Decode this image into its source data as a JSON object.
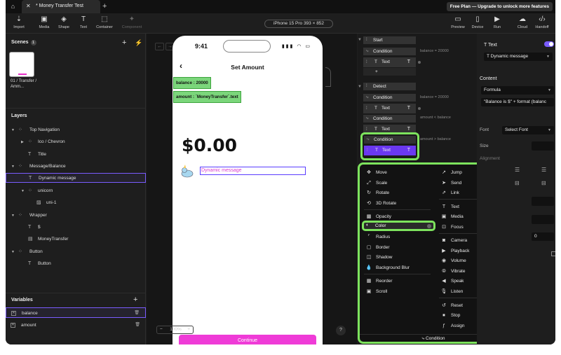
{
  "tabbar": {
    "tab_title": "* Money Transfer Test",
    "new_tab": "+",
    "upgrade": "Free Plan — Upgrade to unlock more features"
  },
  "toolbar": {
    "import": "Import",
    "media": "Media",
    "shape": "Shape",
    "text": "Text",
    "container": "Container",
    "component": "Component",
    "device_selector": "iPhone 15 Pro  393 × 852",
    "preview": "Preview",
    "device": "Device",
    "run": "Run",
    "cloud": "Cloud",
    "handoff": "Handoff"
  },
  "scenes": {
    "heading": "Scenes",
    "count": "1",
    "scene_label": "01 / Transfer / Amm..."
  },
  "layers": {
    "heading": "Layers",
    "items": [
      {
        "label": "Top Navigation",
        "icon": "frame-icon"
      },
      {
        "label": "Ico / Chevron",
        "icon": "frame-icon"
      },
      {
        "label": "Title",
        "icon": "text-icon"
      },
      {
        "label": "Message/Balance",
        "icon": "frame-icon"
      },
      {
        "label": "Dynamic message",
        "icon": "text-icon"
      },
      {
        "label": "unicorn",
        "icon": "frame-icon"
      },
      {
        "label": "uni-1",
        "icon": "image-icon"
      },
      {
        "label": "Wrapper",
        "icon": "frame-icon"
      },
      {
        "label": "$",
        "icon": "text-icon"
      },
      {
        "label": "MoneyTransfer",
        "icon": "component-icon"
      },
      {
        "label": "Button",
        "icon": "frame-icon"
      },
      {
        "label": "Button",
        "icon": "text-icon"
      }
    ]
  },
  "variables": {
    "heading": "Variables",
    "items": [
      {
        "name": "balance"
      },
      {
        "name": "amount"
      }
    ]
  },
  "canvas": {
    "zoom": "100%",
    "zoom_minus": "−",
    "zoom_plus": "+",
    "help": "?"
  },
  "phone": {
    "time": "9:41",
    "status_icons": "▮▮▮ ◠ ▭",
    "back": "‹",
    "title": "Set Amount",
    "chip_balance": "balance : 20000",
    "chip_amount": "amount : `MoneyTransfer`.text",
    "amount_display": "$0.00",
    "dynamic_message": "Dynamic message",
    "cta": "Continue"
  },
  "logic": {
    "nodes": {
      "start": "Start",
      "condition": "Condition",
      "text": "Text",
      "detect": "Detect",
      "t_icon": "T",
      "add": "+"
    },
    "cond_labels": {
      "c1": "balance = 20000",
      "c2": "balance = 20000",
      "c3": "amount < balance",
      "c4": "amount > balance"
    }
  },
  "menu": {
    "left": [
      "Move",
      "Scale",
      "Rotate",
      "3D Rotate",
      "Opacity",
      "Color",
      "Radius",
      "Border",
      "Shadow",
      "Background Blur",
      "Reorder",
      "Scroll"
    ],
    "right": [
      "Jump",
      "Send",
      "Link",
      "Text",
      "Media",
      "Focus",
      "Camera",
      "Playback",
      "Volume",
      "Vibrate",
      "Speak",
      "Listen",
      "Reset",
      "Stop",
      "Assign"
    ],
    "footer": "Condition"
  },
  "props": {
    "component_name": "Text",
    "layer_select": "Dynamic message",
    "content_heading": "Content",
    "content_type": "Formula",
    "formula": "\"Balance is $\" + format (balanc",
    "font_label": "Font",
    "font_select": "Select Font",
    "size_label": "Size",
    "alignment_label": "Alignment",
    "num_value": "0"
  },
  "colors": {
    "accent_green": "#7de35d",
    "accent_purple": "#6a38f0",
    "cta_pink": "#ef3bd7",
    "chip_green": "#7bd67b",
    "dynamic_text": "#d83ad0"
  }
}
